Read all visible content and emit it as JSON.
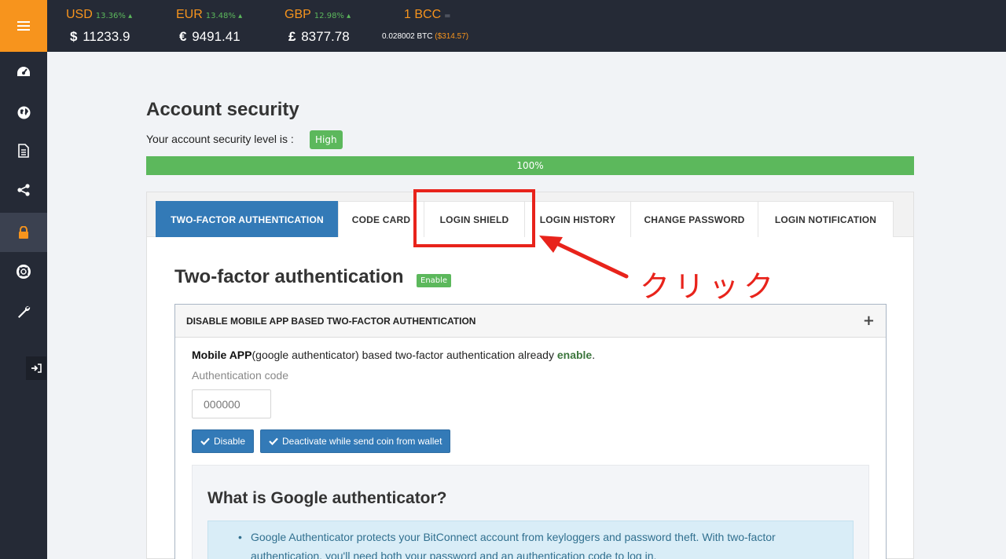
{
  "tickers": [
    {
      "currency": "USD",
      "change": "13.36%",
      "symbol": "$",
      "price": "11233.9"
    },
    {
      "currency": "EUR",
      "change": "13.48%",
      "symbol": "€",
      "price": "9491.41"
    },
    {
      "currency": "GBP",
      "change": "12.98%",
      "symbol": "£",
      "price": "8377.78"
    }
  ],
  "bcc": {
    "label": "1 BCC",
    "btc_value": "0.028002 BTC",
    "usd_value": "($314.57)"
  },
  "sidebar": {
    "items": [
      "dashboard-icon",
      "globe-icon",
      "document-icon",
      "share-icon",
      "lock-icon",
      "lifebuoy-icon",
      "wrench-icon"
    ],
    "active": "lock-icon",
    "logout_icon": "sign-in-icon"
  },
  "security": {
    "title": "Account security",
    "level_text": "Your account security level is :",
    "level_badge": "High",
    "progress_label": "100%",
    "progress_value": 100
  },
  "tabs": [
    {
      "label": "TWO-FACTOR AUTHENTICATION",
      "active": true
    },
    {
      "label": "CODE CARD",
      "active": false
    },
    {
      "label": "LOGIN SHIELD",
      "active": false
    },
    {
      "label": "LOGIN HISTORY",
      "active": false
    },
    {
      "label": "CHANGE PASSWORD",
      "active": false
    },
    {
      "label": "LOGIN NOTIFICATION",
      "active": false
    }
  ],
  "two_factor": {
    "title": "Two-factor authentication",
    "badge": "Enable",
    "panel_title": "DISABLE MOBILE APP BASED TWO-FACTOR AUTHENTICATION",
    "app_bold": "Mobile APP",
    "app_text": "(google authenticator) based two-factor authentication already ",
    "app_enable": "enable",
    "app_period": ".",
    "code_label": "Authentication code",
    "code_placeholder": "000000",
    "disable_button": "Disable",
    "deactivate_button": "Deactivate while send coin from wallet"
  },
  "info": {
    "title": "What is Google authenticator?",
    "note": "Google Authenticator protects your BitConnect account from keyloggers and password theft. With two-factor authentication, you'll need both your password and an authentication code to log in."
  },
  "annotation": {
    "label": "クリック",
    "color": "#e8231b"
  },
  "colors": {
    "accent": "#f7941d",
    "primary": "#337ab7",
    "success": "#5cb85c",
    "dark": "#252a36"
  }
}
